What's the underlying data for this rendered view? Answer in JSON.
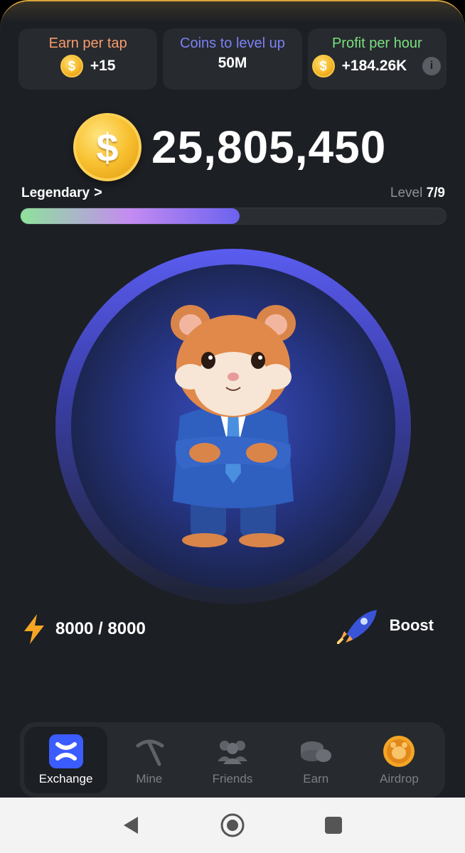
{
  "stats": [
    {
      "label": "Earn per tap",
      "value": "+15",
      "color": "#f89c6a"
    },
    {
      "label": "Coins to level up",
      "value": "50M",
      "color": "#7a82f4"
    },
    {
      "label": "Profit per hour",
      "value": "+184.26K",
      "color": "#7ae07f"
    }
  ],
  "coin_symbol": "$",
  "balance": "25,805,450",
  "league": {
    "name": "Legendary",
    "chevron": ">"
  },
  "level": {
    "label": "Level",
    "value": "7/9"
  },
  "progress_fraction": 0.515,
  "energy": {
    "value": "8000 / 8000",
    "icon": "lightning-icon"
  },
  "boost": {
    "label": "Boost",
    "icon": "rocket-icon"
  },
  "nav": {
    "items": [
      {
        "label": "Exchange",
        "icon": "exchange-icon",
        "active": true
      },
      {
        "label": "Mine",
        "icon": "pickaxe-icon",
        "active": false
      },
      {
        "label": "Friends",
        "icon": "friends-icon",
        "active": false
      },
      {
        "label": "Earn",
        "icon": "coins-icon",
        "active": false
      },
      {
        "label": "Airdrop",
        "icon": "airdrop-icon",
        "active": false
      }
    ]
  },
  "colors": {
    "accent_gold": "#d9a43a",
    "exchange_blue": "#3b5cff",
    "progress_end": "#6b62ef"
  }
}
